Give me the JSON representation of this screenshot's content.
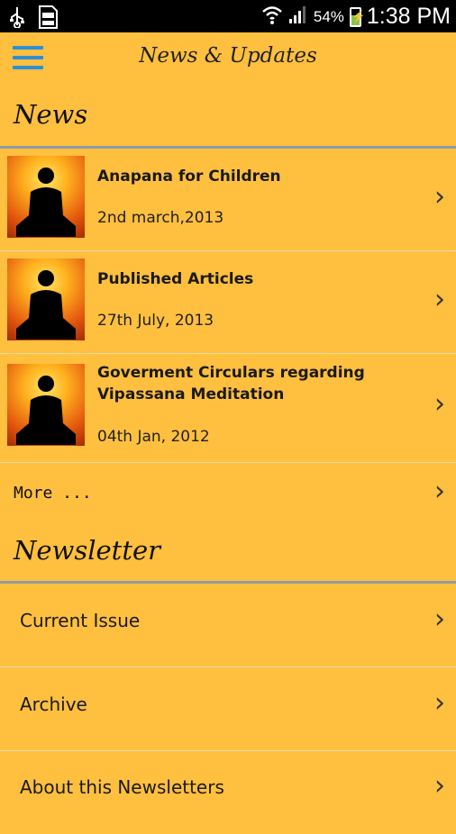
{
  "status_bar": {
    "battery": "54%",
    "time": "1:38 PM"
  },
  "app_bar": {
    "title": "News & Updates"
  },
  "news": {
    "section_title": "News",
    "items": [
      {
        "title": "Anapana for Children",
        "date": "2nd march,2013"
      },
      {
        "title": "Published Articles",
        "date": "27th July, 2013"
      },
      {
        "title": "Goverment Circulars regarding Vipassana Meditation",
        "date": "04th Jan, 2012"
      }
    ],
    "more_label": "More ..."
  },
  "newsletter": {
    "section_title": "Newsletter",
    "items": [
      {
        "label": "Current Issue"
      },
      {
        "label": "Archive"
      },
      {
        "label": "About this Newsletters"
      }
    ]
  },
  "colors": {
    "background": "#FFBF3F",
    "menu_icon": "#2E8FD6",
    "divider": "#8E9BA6"
  },
  "icons": [
    "usb-icon",
    "sd-card-icon",
    "wifi-icon",
    "signal-icon",
    "battery-icon",
    "menu-icon",
    "meditation-thumbnail",
    "chevron-right-icon"
  ]
}
